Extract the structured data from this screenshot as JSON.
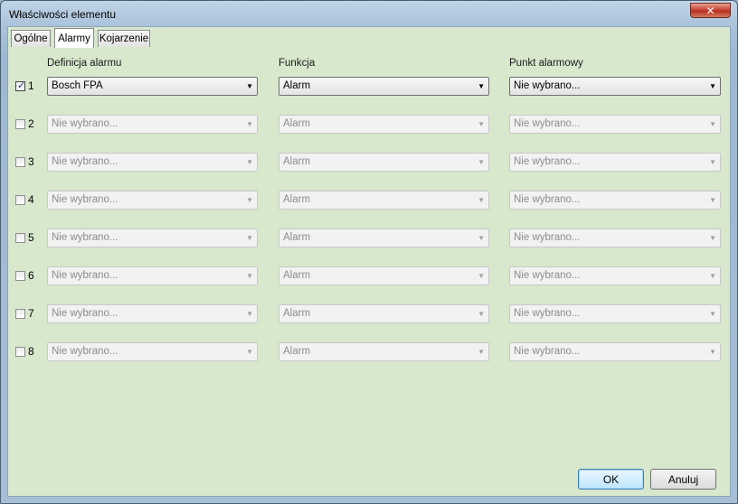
{
  "window": {
    "title": "Właściwości elementu",
    "close_glyph": "✕"
  },
  "tabs": [
    {
      "label": "Ogólne"
    },
    {
      "label": "Alarmy"
    },
    {
      "label": "Kojarzenie"
    }
  ],
  "columns": {
    "definition": "Definicja alarmu",
    "function": "Funkcja",
    "point": "Punkt alarmowy"
  },
  "rows": [
    {
      "num": "1",
      "checked": true,
      "definition": "Bosch FPA",
      "function": "Alarm",
      "point": "Nie wybrano..."
    },
    {
      "num": "2",
      "checked": false,
      "definition": "Nie wybrano...",
      "function": "Alarm",
      "point": "Nie wybrano..."
    },
    {
      "num": "3",
      "checked": false,
      "definition": "Nie wybrano...",
      "function": "Alarm",
      "point": "Nie wybrano..."
    },
    {
      "num": "4",
      "checked": false,
      "definition": "Nie wybrano...",
      "function": "Alarm",
      "point": "Nie wybrano..."
    },
    {
      "num": "5",
      "checked": false,
      "definition": "Nie wybrano...",
      "function": "Alarm",
      "point": "Nie wybrano..."
    },
    {
      "num": "6",
      "checked": false,
      "definition": "Nie wybrano...",
      "function": "Alarm",
      "point": "Nie wybrano..."
    },
    {
      "num": "7",
      "checked": false,
      "definition": "Nie wybrano...",
      "function": "Alarm",
      "point": "Nie wybrano..."
    },
    {
      "num": "8",
      "checked": false,
      "definition": "Nie wybrano...",
      "function": "Alarm",
      "point": "Nie wybrano..."
    }
  ],
  "buttons": {
    "ok": "OK",
    "cancel": "Anuluj"
  },
  "icons": {
    "checkmark": "✓",
    "dropdown": "▼"
  }
}
